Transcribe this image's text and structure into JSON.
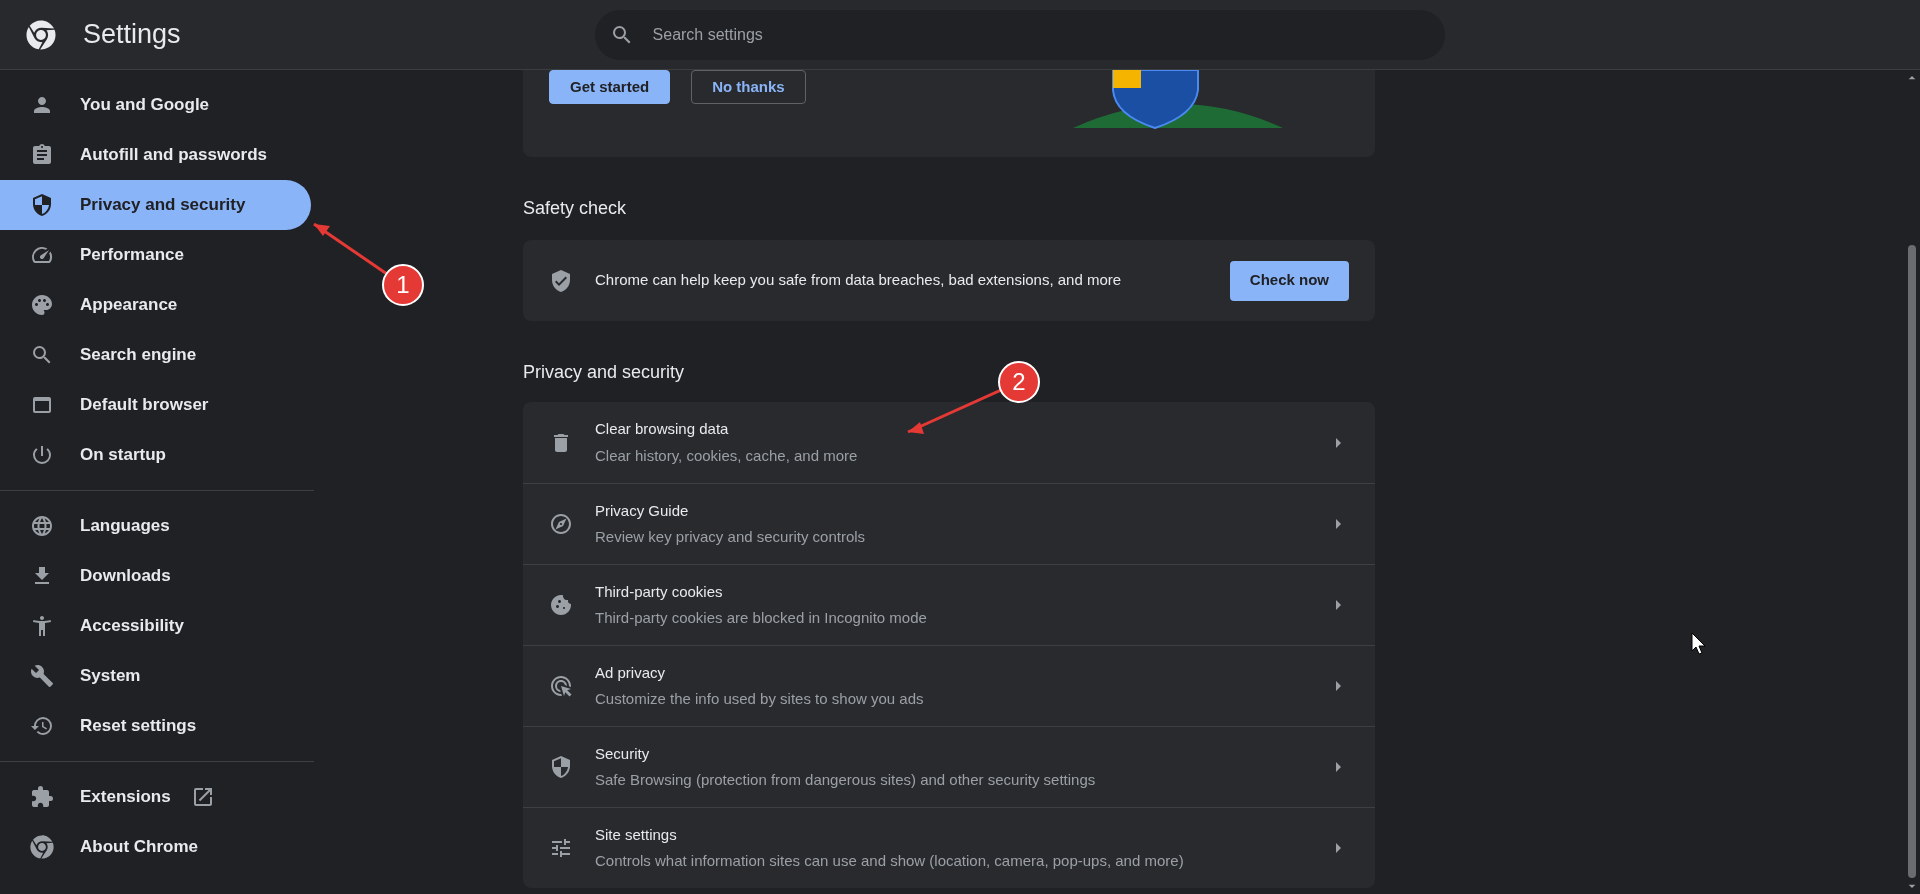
{
  "header": {
    "title": "Settings",
    "search": {
      "placeholder": "Search settings"
    }
  },
  "sidebar": {
    "groups": [
      [
        {
          "label": "You and Google",
          "selected": false
        },
        {
          "label": "Autofill and passwords",
          "selected": false
        },
        {
          "label": "Privacy and security",
          "selected": true
        },
        {
          "label": "Performance",
          "selected": false
        },
        {
          "label": "Appearance",
          "selected": false
        },
        {
          "label": "Search engine",
          "selected": false
        },
        {
          "label": "Default browser",
          "selected": false
        },
        {
          "label": "On startup",
          "selected": false
        }
      ],
      [
        {
          "label": "Languages",
          "selected": false
        },
        {
          "label": "Downloads",
          "selected": false
        },
        {
          "label": "Accessibility",
          "selected": false
        },
        {
          "label": "System",
          "selected": false
        },
        {
          "label": "Reset settings",
          "selected": false
        }
      ],
      [
        {
          "label": "Extensions",
          "selected": false
        },
        {
          "label": "About Chrome",
          "selected": false
        }
      ]
    ]
  },
  "promo": {
    "buttons": [
      {
        "label": "Get started",
        "kind": "primary"
      },
      {
        "label": "No thanks",
        "kind": "outline"
      }
    ]
  },
  "safety_check": {
    "heading": "Safety check",
    "text": "Chrome can help keep you safe from data breaches, bad extensions, and more",
    "button": "Check now"
  },
  "privacy": {
    "heading": "Privacy and security",
    "rows": [
      {
        "title": "Clear browsing data",
        "subtitle": "Clear history, cookies, cache, and more"
      },
      {
        "title": "Privacy Guide",
        "subtitle": "Review key privacy and security controls"
      },
      {
        "title": "Third-party cookies",
        "subtitle": "Third-party cookies are blocked in Incognito mode"
      },
      {
        "title": "Ad privacy",
        "subtitle": "Customize the info used by sites to show you ads"
      },
      {
        "title": "Security",
        "subtitle": "Safe Browsing (protection from dangerous sites) and other security settings"
      },
      {
        "title": "Site settings",
        "subtitle": "Controls what information sites can use and show (location, camera, pop-ups, and more)"
      }
    ]
  },
  "annotations": [
    {
      "label": "1"
    },
    {
      "label": "2"
    }
  ]
}
